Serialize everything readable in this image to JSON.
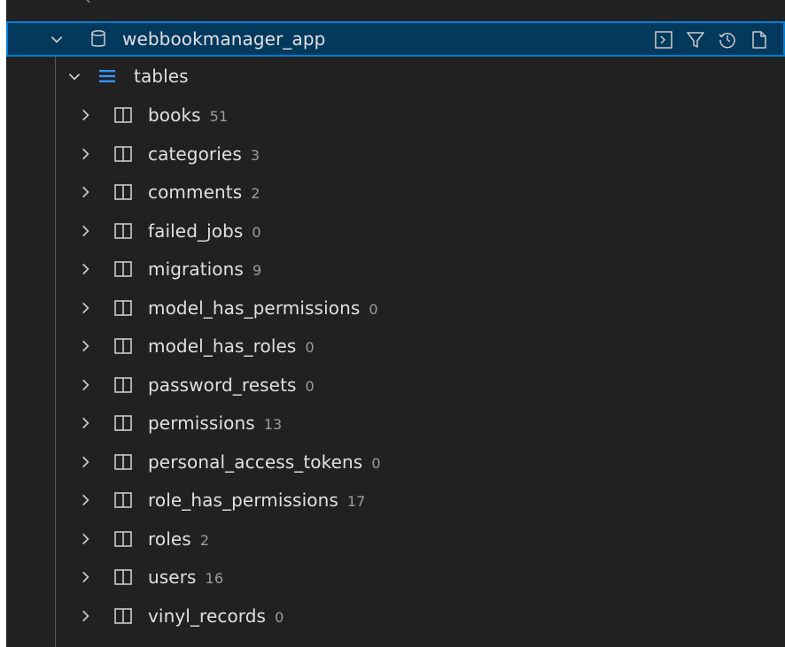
{
  "colors": {
    "panel_bg": "#212121",
    "selection_bg": "#04395e",
    "selection_border": "#007fd4",
    "text": "#e0e0e0",
    "count_text": "#9d9d9d",
    "list_icon": "#3794ff"
  },
  "connection": {
    "label": "webbookmanager_app",
    "icon": "database-icon",
    "toolbar": [
      {
        "name": "open-terminal-button",
        "icon": "terminal-icon"
      },
      {
        "name": "filter-button",
        "icon": "filter-icon"
      },
      {
        "name": "history-button",
        "icon": "history-icon"
      },
      {
        "name": "new-file-button",
        "icon": "file-icon"
      }
    ]
  },
  "tables_group": {
    "label": "tables",
    "icon": "list-icon"
  },
  "tables": [
    {
      "name": "books",
      "count": "51"
    },
    {
      "name": "categories",
      "count": "3"
    },
    {
      "name": "comments",
      "count": "2"
    },
    {
      "name": "failed_jobs",
      "count": "0"
    },
    {
      "name": "migrations",
      "count": "9"
    },
    {
      "name": "model_has_permissions",
      "count": "0"
    },
    {
      "name": "model_has_roles",
      "count": "0"
    },
    {
      "name": "password_resets",
      "count": "0"
    },
    {
      "name": "permissions",
      "count": "13"
    },
    {
      "name": "personal_access_tokens",
      "count": "0"
    },
    {
      "name": "role_has_permissions",
      "count": "17"
    },
    {
      "name": "roles",
      "count": "2"
    },
    {
      "name": "users",
      "count": "16"
    },
    {
      "name": "vinyl_records",
      "count": "0"
    }
  ]
}
